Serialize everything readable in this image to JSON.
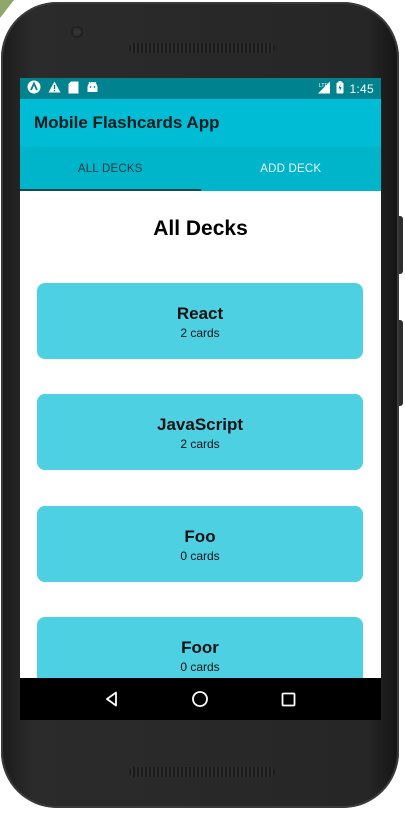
{
  "app": {
    "title": "Mobile Flashcards App"
  },
  "status_bar": {
    "time": "1:45",
    "left_icons": [
      "app-a-icon",
      "warning-icon",
      "sd-card-icon",
      "android-icon"
    ],
    "right_icons": [
      "signal-icon",
      "battery-icon"
    ]
  },
  "tabs": [
    {
      "label": "ALL DECKS",
      "active": true
    },
    {
      "label": "ADD DECK",
      "active": false
    }
  ],
  "main": {
    "heading": "All Decks"
  },
  "decks": [
    {
      "title": "React",
      "count": "2 cards"
    },
    {
      "title": "JavaScript",
      "count": "2 cards"
    },
    {
      "title": "Foo",
      "count": "0 cards"
    },
    {
      "title": "Foor",
      "count": "0 cards"
    }
  ],
  "nav_bar": {
    "buttons": [
      "back-icon",
      "home-icon",
      "recents-icon"
    ]
  },
  "colors": {
    "status_bar": "#00838f",
    "app_bar": "#00bcd4",
    "tab_bar": "#00b5c9",
    "deck_card": "#4dd0e1",
    "nav_bar": "#000000"
  }
}
